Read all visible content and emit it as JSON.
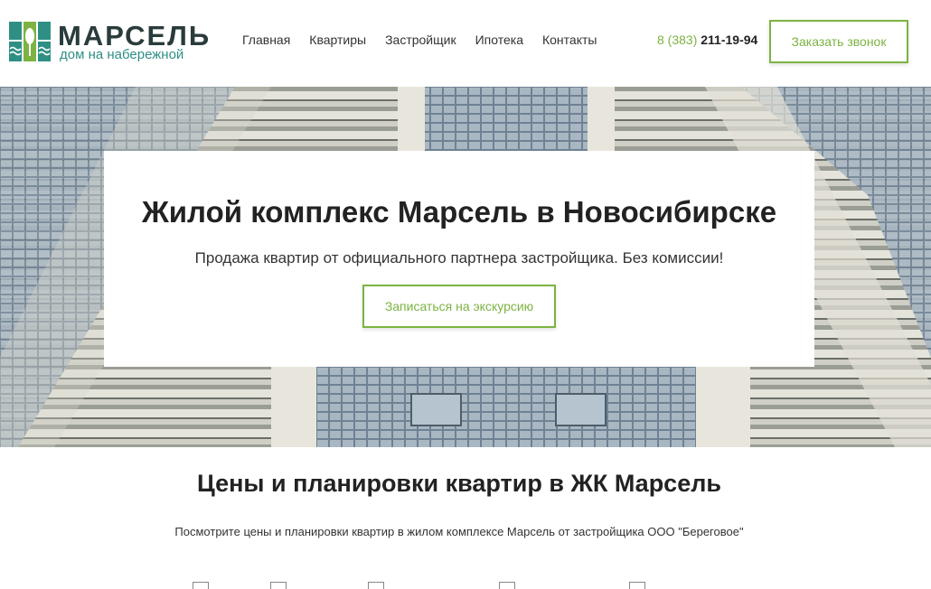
{
  "header": {
    "logo_title": "МАРСЕЛЬ",
    "logo_sub": "дом на набережной",
    "nav": [
      "Главная",
      "Квартиры",
      "Застройщик",
      "Ипотека",
      "Контакты"
    ],
    "phone_code": "8 (383)",
    "phone_number": "211-19-94",
    "call_button": "Заказать звонок"
  },
  "hero": {
    "title": "Жилой комплекс Марсель в Новосибирске",
    "subtitle": "Продажа квартир от официального партнера застройщика. Без комиссии!",
    "tour_button": "Записаться на экскурсию"
  },
  "prices": {
    "title": "Цены и планировки квартир в ЖК Марсель",
    "subtitle": "Посмотрите цены и планировки квартир в жилом комплексе Марсель от застройщика ООО \"Береговое\""
  },
  "colors": {
    "accent": "#7cb342",
    "logo_teal": "#2f8f85",
    "logo_dark": "#2a3b3c"
  }
}
